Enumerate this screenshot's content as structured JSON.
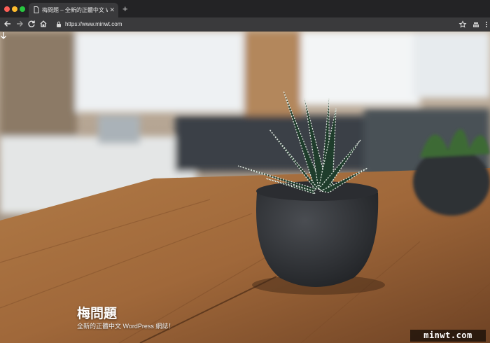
{
  "browser": {
    "tab": {
      "title": "梅問題 – 全新的正體中文 WordPress",
      "close": "✕"
    },
    "new_tab": "+",
    "url": "https://www.minwt.com"
  },
  "hero": {
    "title": "梅問題",
    "subtitle": "全新的正體中文 WordPress 網誌！"
  },
  "watermark": "minwt.com",
  "colors": {
    "tab_strip": "#232325",
    "toolbar": "#3a3a3c",
    "traffic_close": "#fe5f57",
    "traffic_min": "#febc2e",
    "traffic_max": "#28c840",
    "wood": "#a8713f",
    "pot": "#2e3034"
  },
  "icons": [
    "document-icon",
    "back-arrow-icon",
    "forward-arrow-icon",
    "reload-icon",
    "home-icon",
    "lock-icon",
    "star-icon",
    "extension-icon",
    "menu-icon",
    "scroll-down-arrow-icon"
  ]
}
